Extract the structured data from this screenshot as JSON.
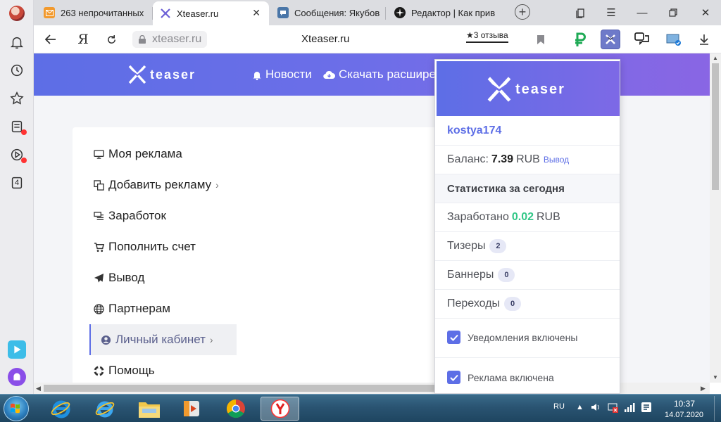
{
  "browser": {
    "tabs": [
      {
        "label": "263 непрочитанных",
        "favicon": "mail-icon",
        "active": false
      },
      {
        "label": "Xteaser.ru",
        "favicon": "xteaser-icon",
        "active": true
      },
      {
        "label": "Сообщения: Якубов",
        "favicon": "chat-icon",
        "active": false
      },
      {
        "label": "Редактор | Как прив",
        "favicon": "star-icon",
        "active": false
      }
    ],
    "address": {
      "domain": "xteaser.ru",
      "page_title": "Xteaser.ru",
      "reviews": "★3 отзыва"
    },
    "sidebar_badge": "4"
  },
  "site": {
    "logo": "teaser",
    "nav": [
      {
        "label": "Новости",
        "icon": "bell-icon"
      },
      {
        "label": "Скачать расшире",
        "icon": "cloud-download-icon"
      }
    ],
    "menu": [
      {
        "label": "Моя реклама",
        "icon": "monitor-icon",
        "has_chevron": false,
        "active": false
      },
      {
        "label": "Добавить рекламу",
        "icon": "copy-icon",
        "has_chevron": true,
        "active": false
      },
      {
        "label": "Заработок",
        "icon": "money-icon",
        "has_chevron": false,
        "active": false
      },
      {
        "label": "Пополнить счет",
        "icon": "cart-icon",
        "has_chevron": false,
        "active": false
      },
      {
        "label": "Вывод",
        "icon": "paper-plane-icon",
        "has_chevron": false,
        "active": false
      },
      {
        "label": "Партнерам",
        "icon": "globe-icon",
        "has_chevron": false,
        "active": false
      },
      {
        "label": "Личный кабинет",
        "icon": "user-circle-icon",
        "has_chevron": true,
        "active": true
      },
      {
        "label": "Помощь",
        "icon": "lifebuoy-icon",
        "has_chevron": false,
        "active": false
      }
    ]
  },
  "popup": {
    "logo": "teaser",
    "username": "kostya174",
    "balance_label": "Баланс:",
    "balance_value": "7.39",
    "balance_currency": "RUB",
    "withdraw_link": "Вывод",
    "stats_heading": "Статистика за сегодня",
    "earned_label": "Заработано",
    "earned_value": "0.02",
    "earned_currency": "RUB",
    "teasers_label": "Тизеры",
    "teasers_count": "2",
    "banners_label": "Баннеры",
    "banners_count": "0",
    "clicks_label": "Переходы",
    "clicks_count": "0",
    "notifications_label": "Уведомления включены",
    "notifications_on": true,
    "ads_label": "Реклама включена",
    "ads_on": true
  },
  "taskbar": {
    "language": "RU",
    "time": "10:37",
    "date": "14.07.2020"
  },
  "colors": {
    "accent": "#5d6ee6",
    "header_end": "#8966e4",
    "green": "#32c787"
  }
}
